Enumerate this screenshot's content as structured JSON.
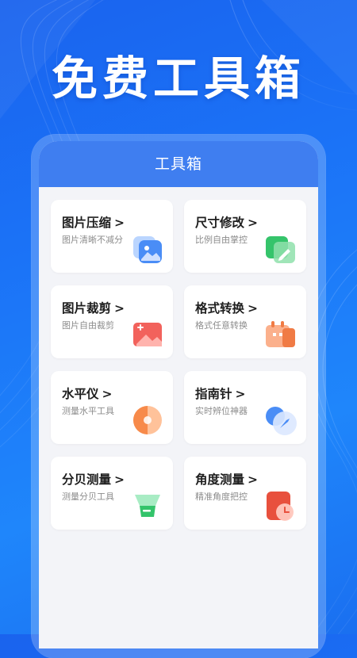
{
  "hero": {
    "title": "免费工具箱"
  },
  "screen": {
    "header_title": "工具箱"
  },
  "tools": [
    {
      "title": "图片压缩",
      "desc": "图片清晰不减分",
      "icon": "image-compress-icon",
      "chevron": ">"
    },
    {
      "title": "尺寸修改",
      "desc": "比例自由掌控",
      "icon": "resize-edit-icon",
      "chevron": ">"
    },
    {
      "title": "图片裁剪",
      "desc": "图片自由裁剪",
      "icon": "image-crop-icon",
      "chevron": ">"
    },
    {
      "title": "格式转换",
      "desc": "格式任意转换",
      "icon": "format-convert-icon",
      "chevron": ">"
    },
    {
      "title": "水平仪",
      "desc": "测量水平工具",
      "icon": "level-icon",
      "chevron": ">"
    },
    {
      "title": "指南针",
      "desc": "实时辨位神器",
      "icon": "compass-icon",
      "chevron": ">"
    },
    {
      "title": "分贝测量",
      "desc": "测量分贝工具",
      "icon": "decibel-icon",
      "chevron": ">"
    },
    {
      "title": "角度测量",
      "desc": "精准角度把控",
      "icon": "angle-icon",
      "chevron": ">"
    }
  ],
  "colors": {
    "background": "#1b73f7",
    "header": "#3f7ef0",
    "card": "#ffffff",
    "screen": "#f3f4f8"
  }
}
